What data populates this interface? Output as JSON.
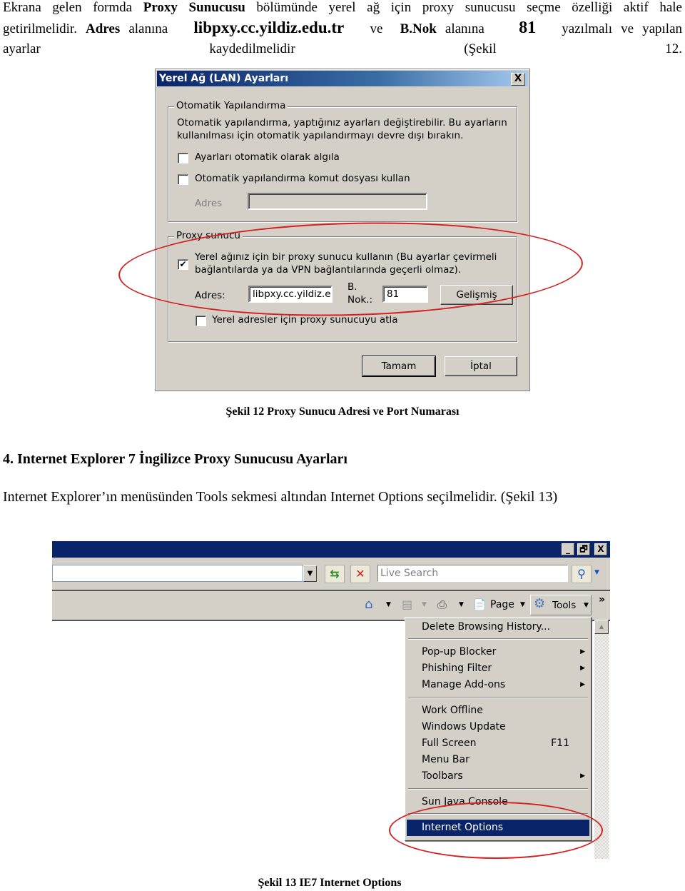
{
  "intro": {
    "line1_a": "Ekrana gelen formda ",
    "line1_bold": "Proxy Sunucusu",
    "line1_b": " bölümünde yerel ağ için proxy sunucusu seçme özelliği aktif hale",
    "line2_a": "getirilmelidir. ",
    "line2_bold_adres": "Adres",
    "line2_b": " alanına ",
    "line2_host": "libpxy.cc.yildiz.edu.tr",
    "line2_c": " ve ",
    "line2_bold_bnok": "B.Nok",
    "line2_d": " alanına ",
    "line2_port": "81",
    "line2_e": " yazılmalı ve yapılan",
    "line3": "ayarlar kaydedilmelidir (Şekil 12."
  },
  "lan_dialog": {
    "title": "Yerel Ağ (LAN) Ayarları",
    "close_label": "X",
    "auto_group": {
      "label": "Otomatik Yapılandırma",
      "description_1": "Otomatik yapılandırma, yaptığınız ayarları değiştirebilir. Bu ayarların",
      "description_2": "kullanılması için otomatik yapılandırmayı devre dışı bırakın.",
      "detect_label": "Ayarları otomatik olarak algıla",
      "detect_checked": false,
      "script_label": "Otomatik yapılandırma komut dosyası kullan",
      "script_checked": false,
      "address_label": "Adres",
      "address_value": ""
    },
    "proxy_group": {
      "label": "Proxy sunucu",
      "use_proxy_label_1": "Yerel ağınız için bir proxy sunucu kullanın (Bu ayarlar çevirmeli",
      "use_proxy_label_2": "bağlantılarda ya da VPN bağlantılarında geçerli olmaz).",
      "use_proxy_checked": true,
      "check_glyph": "✔",
      "address_label": "Adres:",
      "address_value": "libpxy.cc.yildiz.e",
      "port_label_1": "B.",
      "port_label_2": "Nok.:",
      "port_value": "81",
      "advanced_label": "Gelişmiş",
      "bypass_label": "Yerel adresler için proxy sunucuyu atla",
      "bypass_checked": false
    },
    "ok_label": "Tamam",
    "cancel_label": "İptal"
  },
  "caption12": "Şekil 12 Proxy Sunucu Adresi  ve Port Numarası",
  "heading": "4.  Internet Explorer 7 İngilizce Proxy Sunucusu Ayarları",
  "paragraph2": "Internet Explorer’ın menüsünden Tools sekmesi altından Internet Options  seçilmelidir. (Şekil 13)",
  "ie": {
    "window_buttons": {
      "minimize": "_",
      "restore": "🗗",
      "close": "X"
    },
    "address_value": "",
    "search_placeholder": "Live Search",
    "refresh_glyph": "⇆",
    "stop_glyph": "✕",
    "search_glyph": "⚲",
    "chevron_glyph": "»",
    "commands": {
      "page_label": "Page",
      "tools_label": "Tools"
    },
    "tools_menu": [
      {
        "label": "Delete Browsing History...",
        "submenu": false
      },
      {
        "label": "Pop-up Blocker",
        "submenu": true
      },
      {
        "label": "Phishing Filter",
        "submenu": true
      },
      {
        "label": "Manage Add-ons",
        "submenu": true
      },
      {
        "label": "Work Offline",
        "submenu": false
      },
      {
        "label": "Windows Update",
        "submenu": false
      },
      {
        "label": "Full Screen",
        "accelerator": "F11",
        "submenu": false
      },
      {
        "label": "Menu Bar",
        "submenu": false
      },
      {
        "label": "Toolbars",
        "submenu": true
      },
      {
        "label": "Sun Java Console",
        "submenu": false
      },
      {
        "label": "Internet Options",
        "submenu": false,
        "selected": true
      }
    ],
    "submenu_glyph": "▶"
  },
  "caption13": "Şekil 13 IE7 Internet Options",
  "colors": {
    "highlight_ellipse": "#d42020",
    "menu_selected": "#0a246a",
    "window_face": "#d4d0c8"
  }
}
